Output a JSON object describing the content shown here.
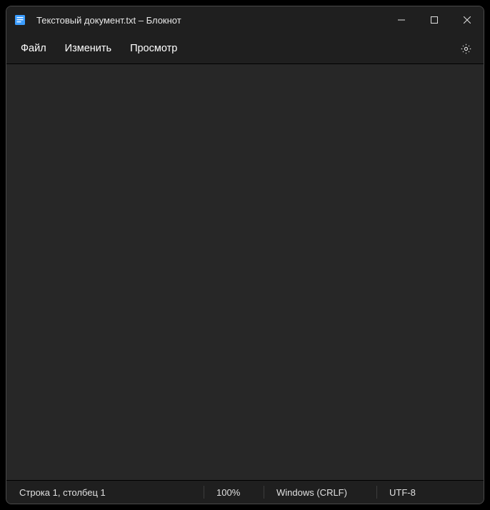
{
  "titlebar": {
    "title": "Текстовый документ.txt – Блокнот"
  },
  "menu": {
    "file": "Файл",
    "edit": "Изменить",
    "view": "Просмотр"
  },
  "editor": {
    "content": ""
  },
  "statusbar": {
    "position": "Строка 1, столбец 1",
    "zoom": "100%",
    "eol": "Windows (CRLF)",
    "encoding": "UTF-8"
  },
  "icons": {
    "app": "notepad-icon",
    "minimize": "minimize-icon",
    "maximize": "maximize-icon",
    "close": "close-icon",
    "settings": "gear-icon"
  }
}
